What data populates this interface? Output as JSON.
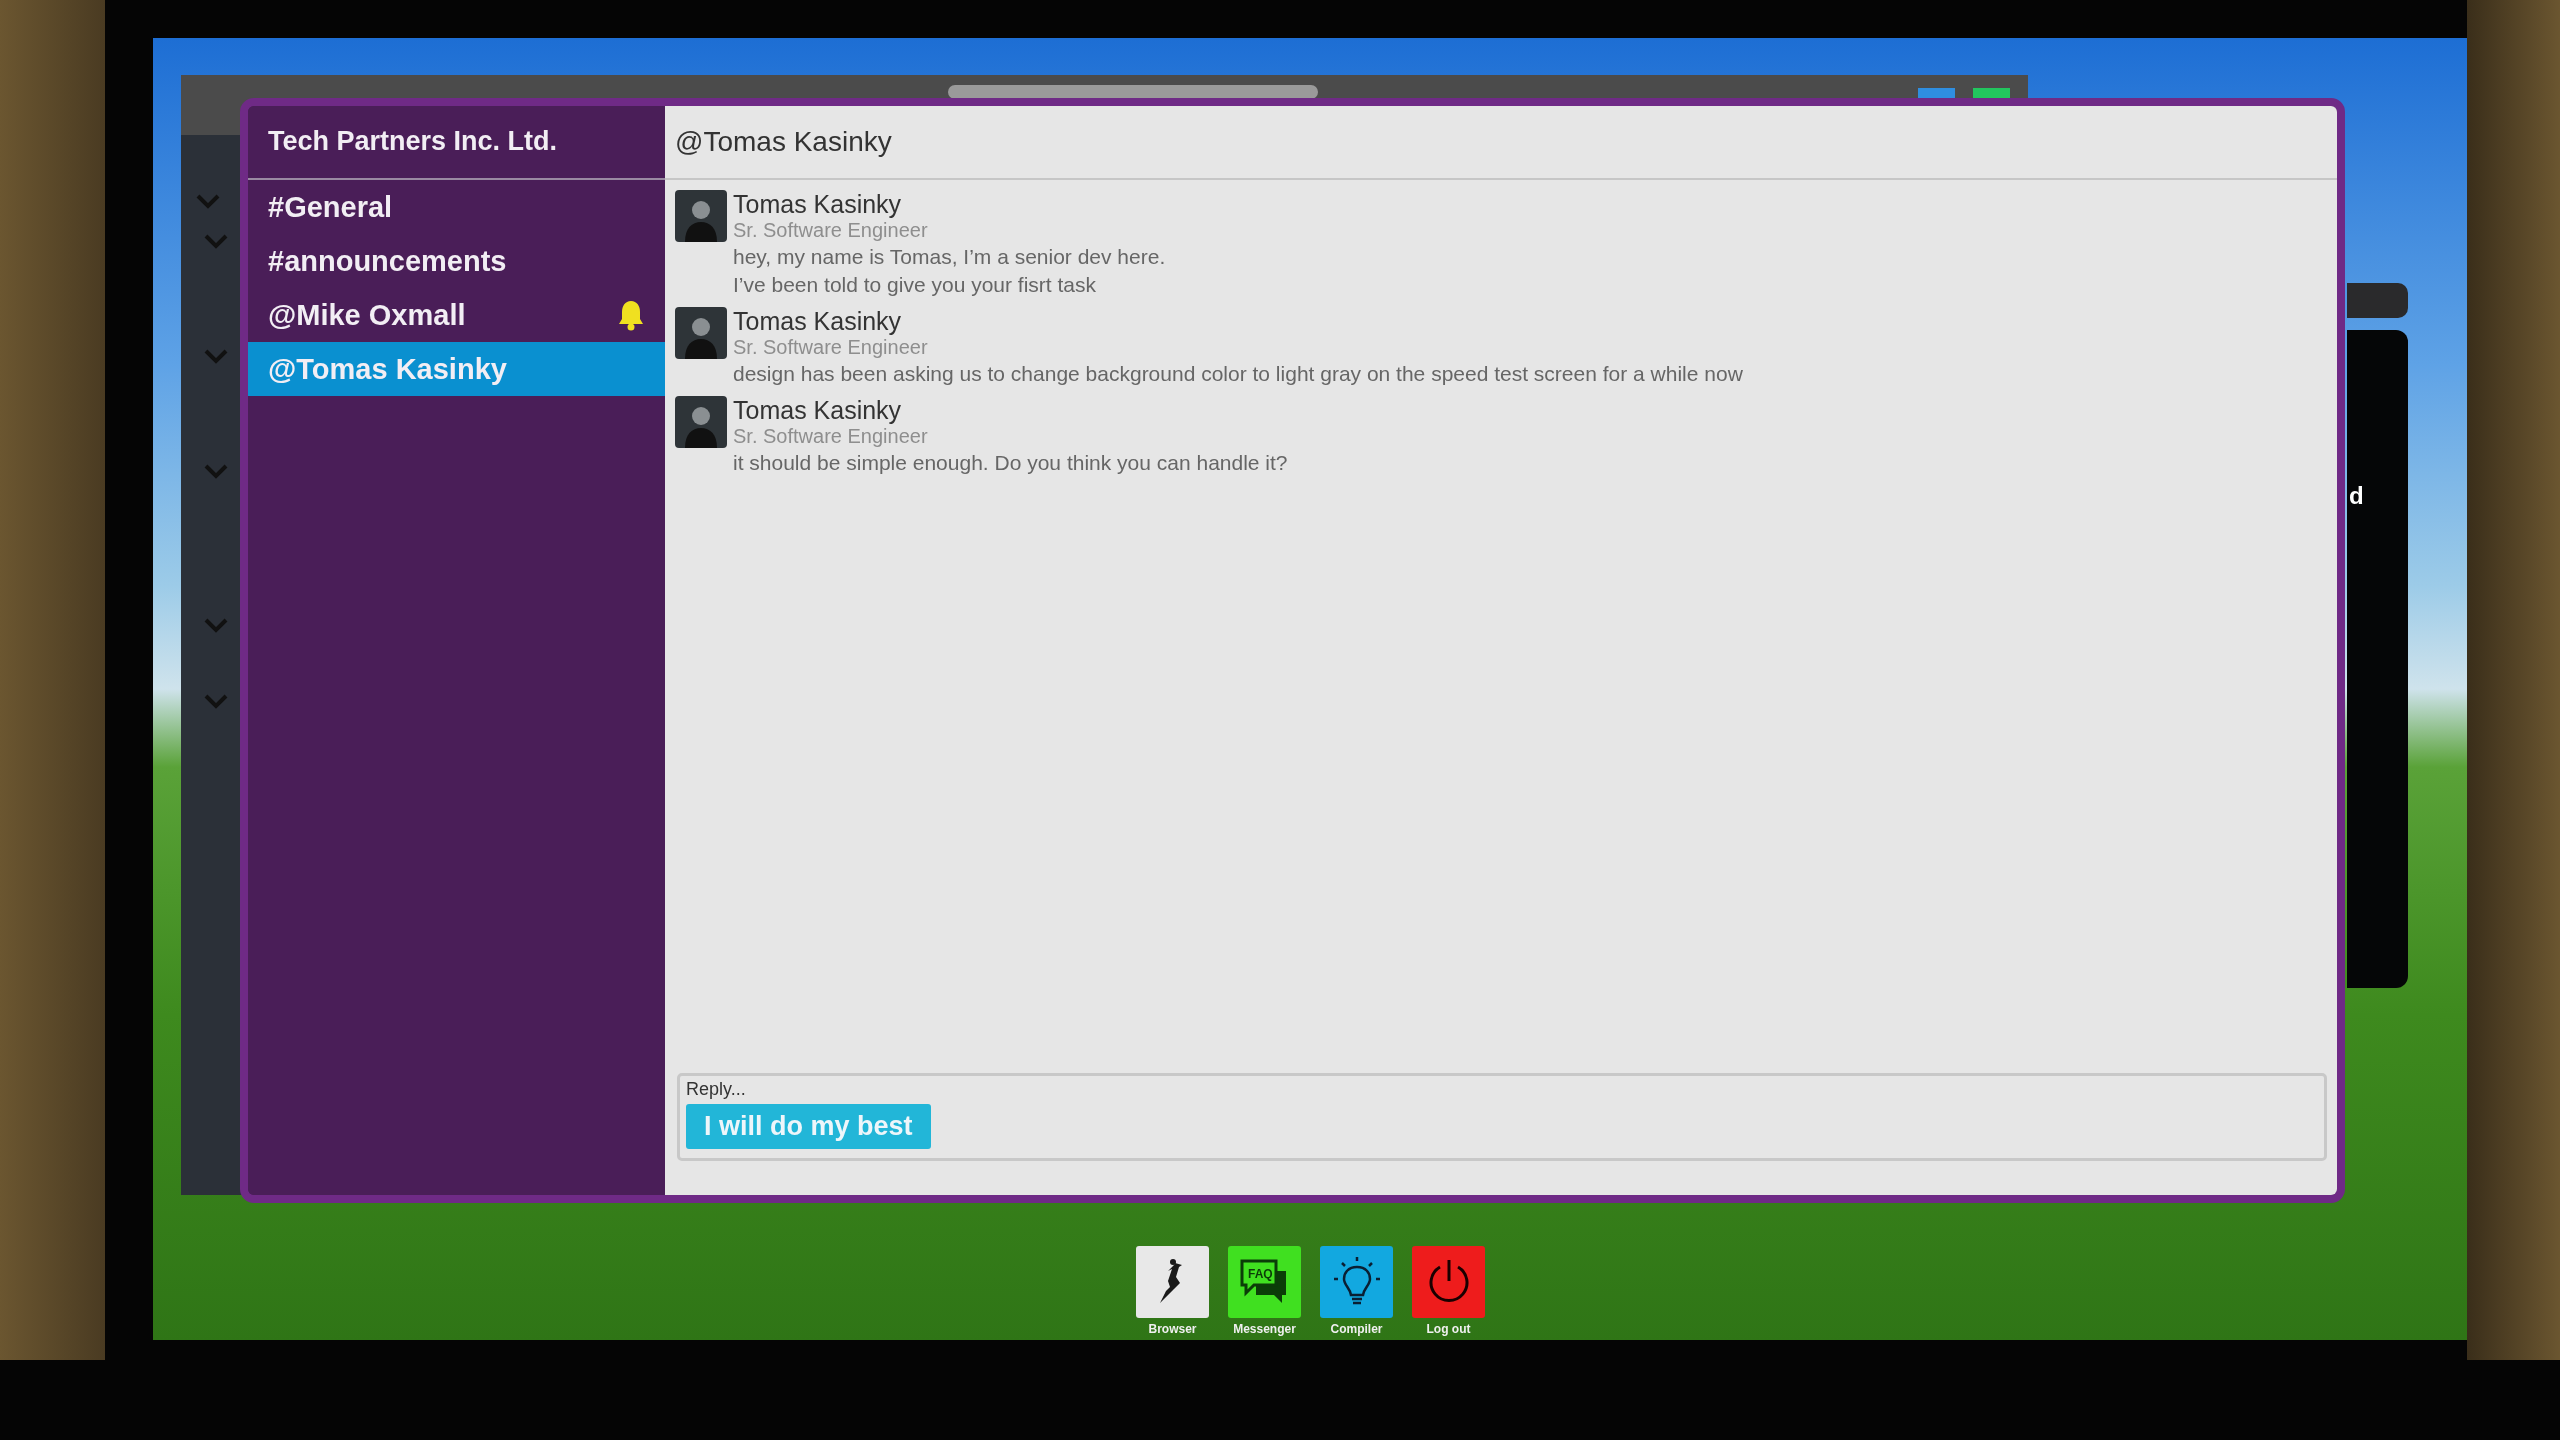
{
  "workspace": {
    "title": "Tech Partners Inc. Ltd."
  },
  "channels": [
    {
      "label": "#General",
      "selected": false,
      "notification": false
    },
    {
      "label": "#announcements",
      "selected": false,
      "notification": false
    },
    {
      "label": "@Mike Oxmall",
      "selected": false,
      "notification": true
    },
    {
      "label": "@Tomas Kasinky",
      "selected": true,
      "notification": false
    }
  ],
  "conversation": {
    "title": "@Tomas Kasinky"
  },
  "messages": [
    {
      "author": "Tomas Kasinky",
      "role": "Sr. Software Engineer",
      "lines": [
        "hey, my name is Tomas, I’m a senior dev here.",
        "I’ve been told to give you your fisrt task"
      ]
    },
    {
      "author": "Tomas Kasinky",
      "role": "Sr. Software Engineer",
      "lines": [
        "design has been asking us to change background color to light gray on the speed test screen for a while now"
      ]
    },
    {
      "author": "Tomas Kasinky",
      "role": "Sr. Software Engineer",
      "lines": [
        "it should be simple enough. Do you think you can handle it?"
      ]
    }
  ],
  "reply": {
    "label": "Reply...",
    "options": [
      "I will do my best"
    ]
  },
  "taskbar": [
    {
      "label": "Browser",
      "kind": "browser"
    },
    {
      "label": "Messenger",
      "kind": "messenger",
      "icon_text": "FAQ"
    },
    {
      "label": "Compiler",
      "kind": "compiler"
    },
    {
      "label": "Log out",
      "kind": "logout"
    }
  ],
  "background_window": {
    "text": "d"
  }
}
